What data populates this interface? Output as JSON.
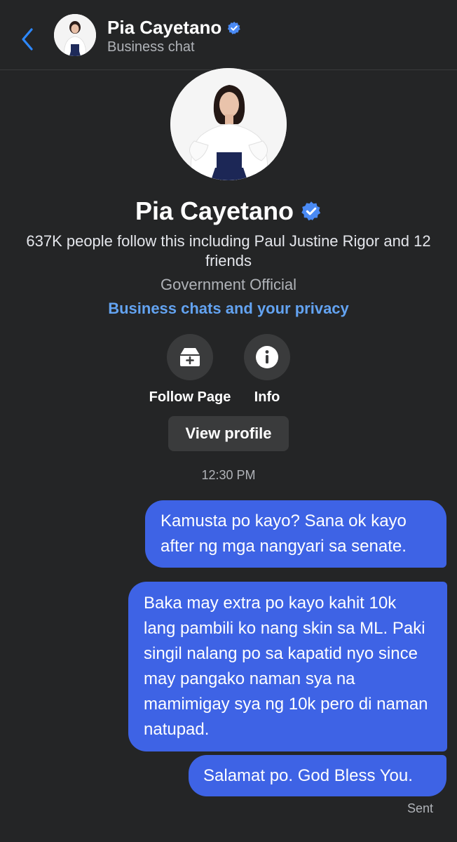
{
  "header": {
    "name": "Pia Cayetano",
    "subtitle": "Business chat"
  },
  "profile": {
    "name": "Pia Cayetano",
    "followers_line": "637K people follow this including Paul Justine Rigor and 12 friends",
    "category": "Government Official",
    "privacy_link": "Business chats and your privacy",
    "actions": [
      {
        "label": "Follow Page",
        "icon": "follow-page-icon"
      },
      {
        "label": "Info",
        "icon": "info-icon"
      }
    ],
    "view_profile_label": "View profile"
  },
  "timestamp": "12:30 PM",
  "messages": [
    {
      "text": "Kamusta po kayo? Sana ok kayo after ng mga nangyari sa senate."
    },
    {
      "text": "Baka may extra po kayo kahit 10k lang pambili ko nang skin sa ML. Paki singil nalang po sa kapatid nyo since may pangako naman sya na mamimigay sya ng 10k pero di naman natupad."
    },
    {
      "text": "Salamat po. God Bless You."
    }
  ],
  "status": "Sent",
  "colors": {
    "background": "#242526",
    "accent": "#3e63e5",
    "link": "#63a3f1",
    "verified": "#4a8af4"
  }
}
